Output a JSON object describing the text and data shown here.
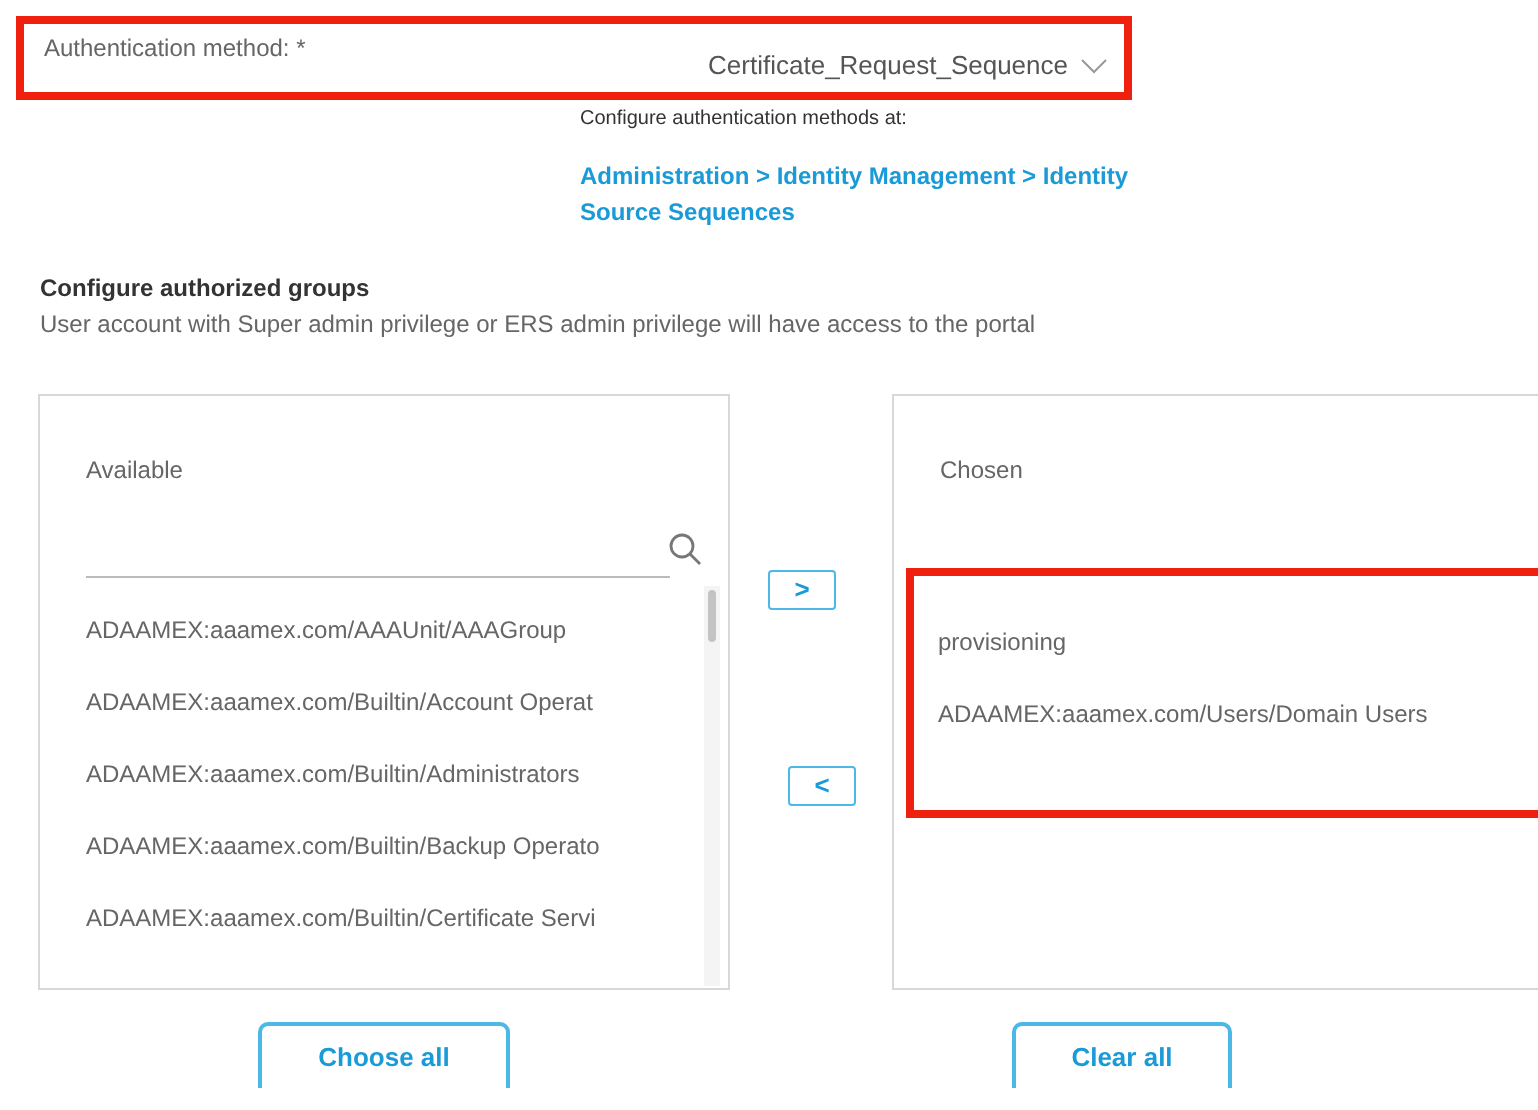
{
  "auth": {
    "label": "Authentication method: *",
    "value": "Certificate_Request_Sequence",
    "highlighted": true
  },
  "help": {
    "text": "Configure authentication methods at:",
    "link": "Administration > Identity Management > Identity Source Sequences"
  },
  "groups": {
    "title": "Configure authorized groups",
    "description": "User account with Super admin privilege or ERS admin privilege will have access to the portal"
  },
  "available": {
    "title": "Available",
    "items": [
      "ADAAMEX:aaamex.com/AAAUnit/AAAGroup",
      "ADAAMEX:aaamex.com/Builtin/Account Operat",
      "ADAAMEX:aaamex.com/Builtin/Administrators",
      "ADAAMEX:aaamex.com/Builtin/Backup Operato",
      "ADAAMEX:aaamex.com/Builtin/Certificate Servi"
    ],
    "button": "Choose all"
  },
  "move_buttons": [
    {
      "glyph": ">"
    },
    {
      "glyph": "<"
    }
  ],
  "chosen": {
    "title": "Chosen",
    "items": [
      "provisioning",
      "ADAAMEX:aaamex.com/Users/Domain Users"
    ],
    "highlighted": true,
    "button": "Clear all"
  }
}
